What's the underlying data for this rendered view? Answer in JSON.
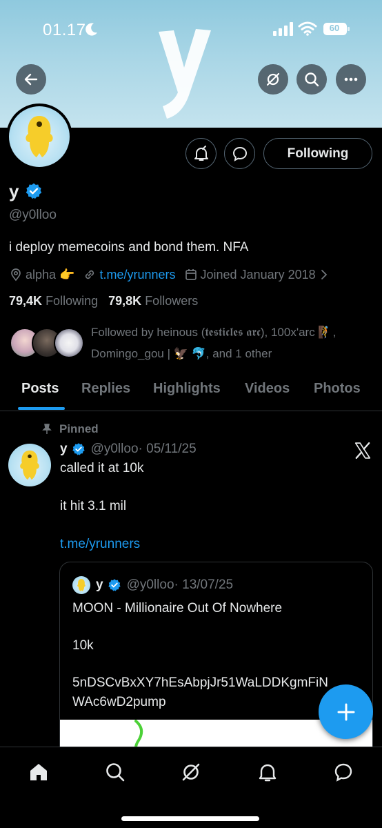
{
  "status_bar": {
    "time": "01.17",
    "battery": "60"
  },
  "banner": {
    "letter": "y"
  },
  "profile": {
    "name": "y",
    "handle": "@y0lloo",
    "bio": "i deploy memecoins and bond them. NFA",
    "location": "alpha 👉",
    "link": "t.me/yrunners",
    "joined": "Joined January 2018",
    "following_count": "79,4K",
    "following_label": "Following",
    "followers_count": "79,8K",
    "followers_label": "Followers",
    "followed_by": "Followed by heinous (𝖙𝖊𝖘𝖙𝖎𝖈𝖑𝖊𝖘 𝖆𝖗𝖈), 100x'arc 🧗, Domingo_gou | 🦅 🐬, and 1 other",
    "follow_button": "Following"
  },
  "tabs": [
    "Posts",
    "Replies",
    "Highlights",
    "Videos",
    "Photos"
  ],
  "pinned_post": {
    "pinned_label": "Pinned",
    "author": "y",
    "handle": "@y0lloo",
    "date": "· 05/11/25",
    "line1": "called it at 10k",
    "line2": "it hit 3.1 mil",
    "link": "t.me/yrunners",
    "quote": {
      "author": "y",
      "handle": "@y0lloo",
      "date": "· 13/07/25",
      "line1": "MOON - Millionaire Out Of Nowhere",
      "line2": "10k",
      "line3": "5nDSCvBxXY7hEsAbpjJr51WaLDDKgmFiN",
      "line4": "WAc6wD2pump"
    }
  },
  "colors": {
    "accent": "#1d9bf0",
    "muted": "#71767b",
    "border": "#2f3336"
  },
  "icons": [
    "back-icon",
    "grok-icon",
    "search-icon",
    "more-icon",
    "notify-icon",
    "message-icon",
    "location-icon",
    "link-icon",
    "calendar-icon",
    "verified-icon",
    "pin-icon",
    "x-logo-icon",
    "compose-icon",
    "home-icon",
    "bell-icon"
  ]
}
